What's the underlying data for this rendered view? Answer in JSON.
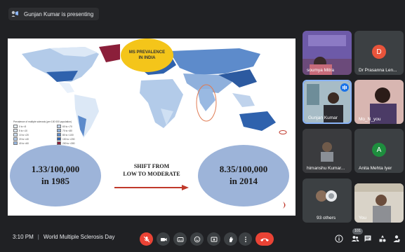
{
  "presenter_chip": {
    "text": "Gunjan Kumar is presenting",
    "icon": "present-icon"
  },
  "slide": {
    "bubble_title": "MS PREVALENCE IN INDIA",
    "legend_title": "Prevalence of multiple sclerosis (per 100 000 population)",
    "legend_items": [
      {
        "label": "0 to <5",
        "color": "#e9f1fb"
      },
      {
        "label": "60 to <70",
        "color": "#c0d3ec"
      },
      {
        "label": "5 to <10",
        "color": "#dce8f6"
      },
      {
        "label": "70 to <80",
        "color": "#8fb0dc"
      },
      {
        "label": "10 to <20",
        "color": "#cfe0f3"
      },
      {
        "label": "80 to <100",
        "color": "#5d8bcb"
      },
      {
        "label": "20 to <40",
        "color": "#b3cbe9"
      },
      {
        "label": "100 to <200",
        "color": "#2f62ad"
      },
      {
        "label": "40 to <60",
        "color": "#99b9e2"
      },
      {
        "label": "200 to <300",
        "color": "#8b1f3a"
      }
    ],
    "stat_left": {
      "rate": "1.33/100,000",
      "year": "in 1985"
    },
    "stat_right": {
      "rate": "8.35/100,000",
      "year": "in 2014"
    },
    "shift_line1": "SHIFT FROM",
    "shift_line2": "LOW TO MODERATE",
    "colors": {
      "bubble": "#f4c51a",
      "stat": "#9db4d9",
      "arrow": "#c0392b",
      "map_dark": "#2c5aa0"
    }
  },
  "participants": [
    {
      "name": "soumya Mitra",
      "kind": "video"
    },
    {
      "name": "Dr Prasanna Len...",
      "kind": "avatar",
      "initial": "D",
      "color": "#e8543b"
    },
    {
      "name": "Gunjan Kumar",
      "kind": "video",
      "active": true
    },
    {
      "name": "Mo_N_you",
      "kind": "video"
    },
    {
      "name": "himanshu Kumar...",
      "kind": "video"
    },
    {
      "name": "Anita Mehta Iyer",
      "kind": "avatar",
      "initial": "A",
      "color": "#1e8e3e"
    },
    {
      "name": "93 others",
      "kind": "others"
    },
    {
      "name": "You",
      "kind": "video"
    }
  ],
  "bottom": {
    "time": "3:10 PM",
    "meeting": "World Multiple Sclerosis Day",
    "participants_count": "101",
    "controls": [
      "mic-off-icon",
      "camera-icon",
      "captions-icon",
      "emoji-icon",
      "present-screen-icon",
      "raise-hand-icon",
      "more-icon",
      "end-call-icon"
    ],
    "right_icons": [
      "info-icon",
      "people-icon",
      "chat-icon",
      "activities-icon",
      "host-controls-icon"
    ]
  }
}
